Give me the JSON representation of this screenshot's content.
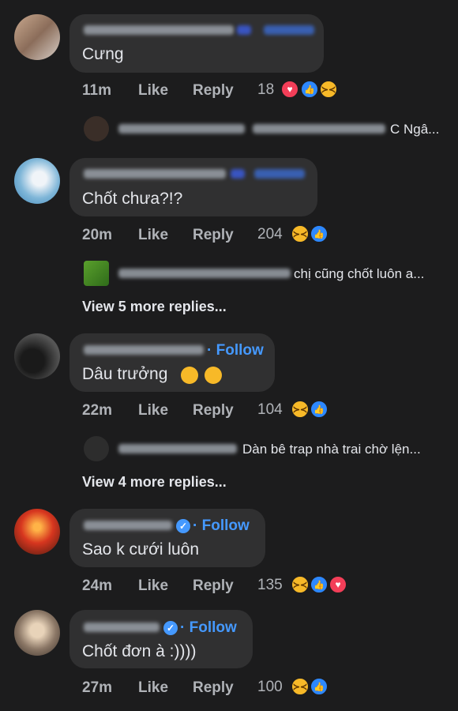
{
  "comments": [
    {
      "text": "Cưng",
      "time": "11m",
      "like": "Like",
      "reply": "Reply",
      "count": "18"
    },
    {
      "text": "Chốt chưa?!?",
      "time": "20m",
      "like": "Like",
      "reply": "Reply",
      "count": "204",
      "reply_preview": "chị cũng chốt luôn a...",
      "more": "View 5 more replies..."
    },
    {
      "text": "Dâu trưởng",
      "time": "22m",
      "like": "Like",
      "reply": "Reply",
      "count": "104",
      "follow": "· Follow",
      "reply_preview": "Dàn bê trap nhà trai chờ lện...",
      "more": "View 4 more replies..."
    },
    {
      "text": "Sao k cưới luôn",
      "time": "24m",
      "like": "Like",
      "reply": "Reply",
      "count": "135",
      "follow": "· Follow"
    },
    {
      "text": "Chốt đơn à :))))",
      "time": "27m",
      "like": "Like",
      "reply": "Reply",
      "count": "100",
      "follow": "· Follow"
    }
  ],
  "reply_preview_1": "C Ngâ...",
  "colors": {
    "background": "#1c1c1d",
    "bubble": "#303031",
    "link": "#4599ff",
    "muted": "#b0b3b8"
  }
}
